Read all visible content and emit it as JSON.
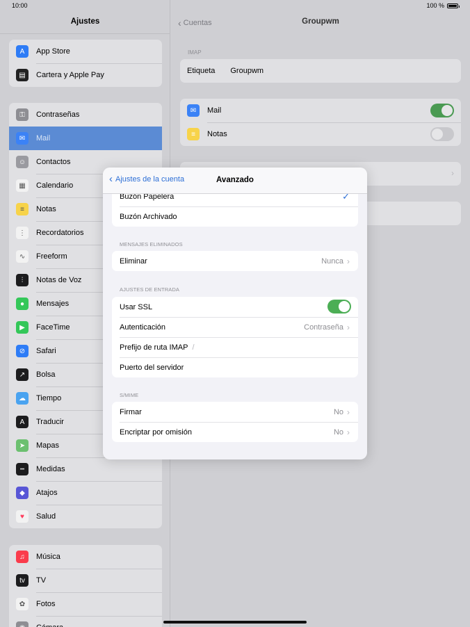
{
  "status": {
    "time": "10:00",
    "battery": "100 %"
  },
  "sidebar": {
    "title": "Ajustes",
    "group1": [
      {
        "label": "App Store",
        "icon": "app-store-icon",
        "color": "#2e7cf6",
        "glyph": "A"
      },
      {
        "label": "Cartera y Apple Pay",
        "icon": "wallet-icon",
        "color": "#222222",
        "glyph": "▤"
      }
    ],
    "group2": [
      {
        "label": "Contraseñas",
        "icon": "key-icon",
        "color": "#8e8e93",
        "glyph": "⚿"
      },
      {
        "label": "Mail",
        "icon": "mail-icon",
        "color": "#3b82f6",
        "glyph": "✉"
      },
      {
        "label": "Contactos",
        "icon": "contacts-icon",
        "color": "#9a9aa0",
        "glyph": "☺"
      },
      {
        "label": "Calendario",
        "icon": "calendar-icon",
        "color": "#f2f2f2",
        "glyph": "▦"
      },
      {
        "label": "Notas",
        "icon": "notes-icon",
        "color": "#f7d34a",
        "glyph": "≡"
      },
      {
        "label": "Recordatorios",
        "icon": "reminders-icon",
        "color": "#f2f2f2",
        "glyph": "⋮"
      },
      {
        "label": "Freeform",
        "icon": "freeform-icon",
        "color": "#f2f2f2",
        "glyph": "∿"
      },
      {
        "label": "Notas de Voz",
        "icon": "voice-memos-icon",
        "color": "#1c1c1e",
        "glyph": "⫶"
      },
      {
        "label": "Mensajes",
        "icon": "messages-icon",
        "color": "#34c759",
        "glyph": "●"
      },
      {
        "label": "FaceTime",
        "icon": "facetime-icon",
        "color": "#34c759",
        "glyph": "▶"
      },
      {
        "label": "Safari",
        "icon": "safari-icon",
        "color": "#2e7cf6",
        "glyph": "⊘"
      },
      {
        "label": "Bolsa",
        "icon": "stocks-icon",
        "color": "#1c1c1e",
        "glyph": "↗"
      },
      {
        "label": "Tiempo",
        "icon": "weather-icon",
        "color": "#4aa3f0",
        "glyph": "☁"
      },
      {
        "label": "Traducir",
        "icon": "translate-icon",
        "color": "#1c1c1e",
        "glyph": "A"
      },
      {
        "label": "Mapas",
        "icon": "maps-icon",
        "color": "#6cc070",
        "glyph": "➤"
      },
      {
        "label": "Medidas",
        "icon": "measure-icon",
        "color": "#1c1c1e",
        "glyph": "┅"
      },
      {
        "label": "Atajos",
        "icon": "shortcuts-icon",
        "color": "#5856d6",
        "glyph": "◆"
      },
      {
        "label": "Salud",
        "icon": "health-icon",
        "color": "#f2f2f2",
        "glyph": "♥"
      }
    ],
    "group3": [
      {
        "label": "Música",
        "icon": "music-icon",
        "color": "#fa3c4c",
        "glyph": "♫"
      },
      {
        "label": "TV",
        "icon": "tv-icon",
        "color": "#1c1c1e",
        "glyph": "tv"
      },
      {
        "label": "Fotos",
        "icon": "photos-icon",
        "color": "#f2f2f2",
        "glyph": "✿"
      },
      {
        "label": "Cámara",
        "icon": "camera-icon",
        "color": "#8e8e93",
        "glyph": "◉"
      }
    ]
  },
  "detail": {
    "back": "Cuentas",
    "title": "Groupwm",
    "imap_header": "IMAP",
    "label_key": "Etiqueta",
    "label_value": "Groupwm",
    "mail": "Mail",
    "notes": "Notas"
  },
  "modal": {
    "back": "Ajustes de la cuenta",
    "title": "Avanzado",
    "mailbox_rows": [
      "Buzón Papelera",
      "Buzón Archivado"
    ],
    "deleted_header": "MENSAJES ELIMINADOS",
    "delete_label": "Eliminar",
    "delete_value": "Nunca",
    "incoming_header": "AJUSTES DE ENTRADA",
    "ssl_label": "Usar SSL",
    "auth_label": "Autenticación",
    "auth_value": "Contraseña",
    "prefix_label": "Prefijo de ruta IMAP",
    "prefix_value": "/",
    "port_label": "Puerto del servidor",
    "smime_header": "S/MIME",
    "sign_label": "Firmar",
    "sign_value": "No",
    "encrypt_label": "Encriptar por omisión",
    "encrypt_value": "No"
  }
}
